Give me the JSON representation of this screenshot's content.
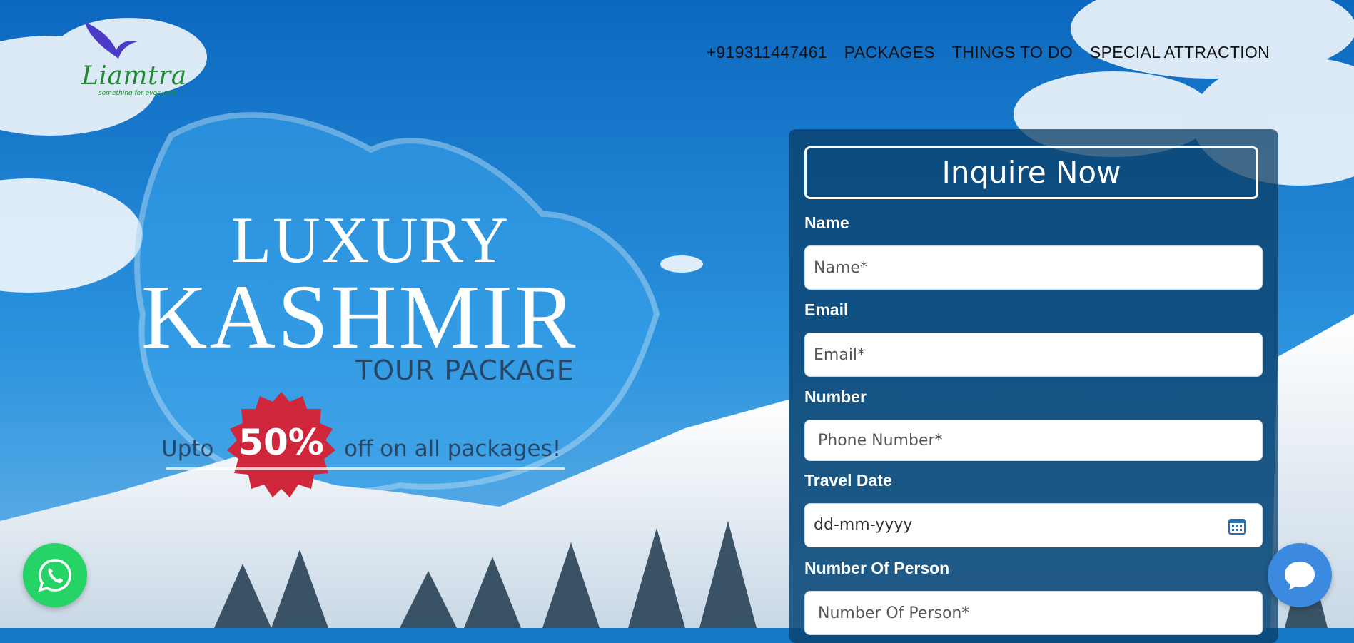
{
  "colors": {
    "sky_top": "#0d6fc7",
    "sky_mid": "#2b93de",
    "form_bg": "rgba(10,60,100,0.75)",
    "badge_red": "#d0263b",
    "whatsapp_green": "#25d366",
    "chat_blue": "#3b8ae0",
    "text_dark_blue": "#264768"
  },
  "logo": {
    "name": "Liamtra",
    "tagline": "something for everyone"
  },
  "nav": {
    "phone": "+919311447461",
    "items": [
      "PACKAGES",
      "THINGS TO DO",
      "SPECIAL ATTRACTION"
    ]
  },
  "hero": {
    "line1": "LUXURY",
    "line2": "KASHMIR",
    "line3": "TOUR PACKAGE",
    "offer_prefix": "Upto",
    "offer_badge": "50%",
    "offer_suffix": "off on all packages!"
  },
  "form": {
    "title": "Inquire Now",
    "name_label": "Name",
    "name_placeholder": "Name*",
    "email_label": "Email",
    "email_placeholder": "Email*",
    "number_label": "Number",
    "number_placeholder": "Phone Number*",
    "date_label": "Travel Date",
    "date_placeholder": "dd-mm-yyyy",
    "persons_label": "Number Of Person",
    "persons_placeholder": "Number Of Person*"
  },
  "icons": {
    "whatsapp": "whatsapp-icon",
    "chat": "chat-icon",
    "calendar": "calendar-icon"
  }
}
